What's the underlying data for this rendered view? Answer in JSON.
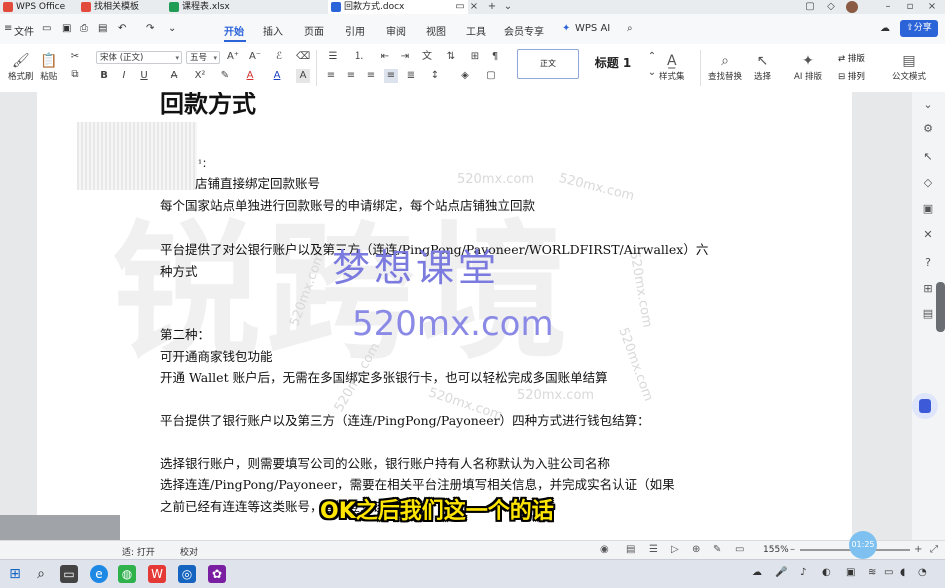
{
  "tabs": [
    {
      "label": "WPS Office",
      "color": "#e24b3b"
    },
    {
      "label": "找相关模板",
      "color": "#e24b3b"
    },
    {
      "label": "课程表.xlsx",
      "color": "#1f9d55"
    },
    {
      "label": "回款方式.docx",
      "color": "#2b63d9",
      "active": true
    }
  ],
  "menu": {
    "file_label": "文件",
    "items": [
      "开始",
      "插入",
      "页面",
      "引用",
      "审阅",
      "视图",
      "工具",
      "会员专享",
      "WPS AI"
    ],
    "active": "开始",
    "share_label": "分享"
  },
  "ribbon": {
    "format_painter": "格式刷",
    "paste": "粘贴",
    "font_name": "宋体 (正文)",
    "font_size": "五号",
    "style_normal": "正文",
    "style_heading": "标题 1",
    "style_set": "样式集",
    "find_replace": "查找替换",
    "select": "选择",
    "ai_layout": "AI 排版",
    "layout": "排版",
    "arrange": "排列",
    "official_mode": "公文模式"
  },
  "document": {
    "title": "回款方式",
    "lines": [
      "¹：",
      "店铺直接绑定回款账号",
      "每个国家站点单独进行回款账号的申请绑定，每个站点店铺独立回款",
      "平台提供了对公银行账户以及第三方（连连/PingPong/Payoneer/WORLDFIRST/Airwallex）六",
      "种方式",
      "第二种：",
      "可开通商家钱包功能",
      "开通 Wallet 账户后，无需在多国绑定多张银行卡，也可以轻松完成多国账单结算",
      "平台提供了银行账户以及第三方（连连/PingPong/Payoneer）四种方式进行钱包结算：",
      "选择银行账户，则需要填写公司的公账，银行账户持有人名称默认为入驻公司名称",
      "选择连连/PingPong/Payoneer，需要在相关平台注册填写相关信息，并完成实名认证（如果",
      "之前已经有连连等这类账号，直接登录该账号）"
    ]
  },
  "watermarks": {
    "cn": "梦想课堂",
    "en": "520mx.com",
    "small": "520mx.com",
    "big": "锐跨境"
  },
  "subtitle": "OK之后我们这一个的话",
  "status": {
    "left": "适: 打开",
    "proofread": "校对",
    "zoom": "155%",
    "zoom_ball": "01:25"
  },
  "colors": {
    "accent": "#2b63d9",
    "subtitle": "#ffe600"
  }
}
